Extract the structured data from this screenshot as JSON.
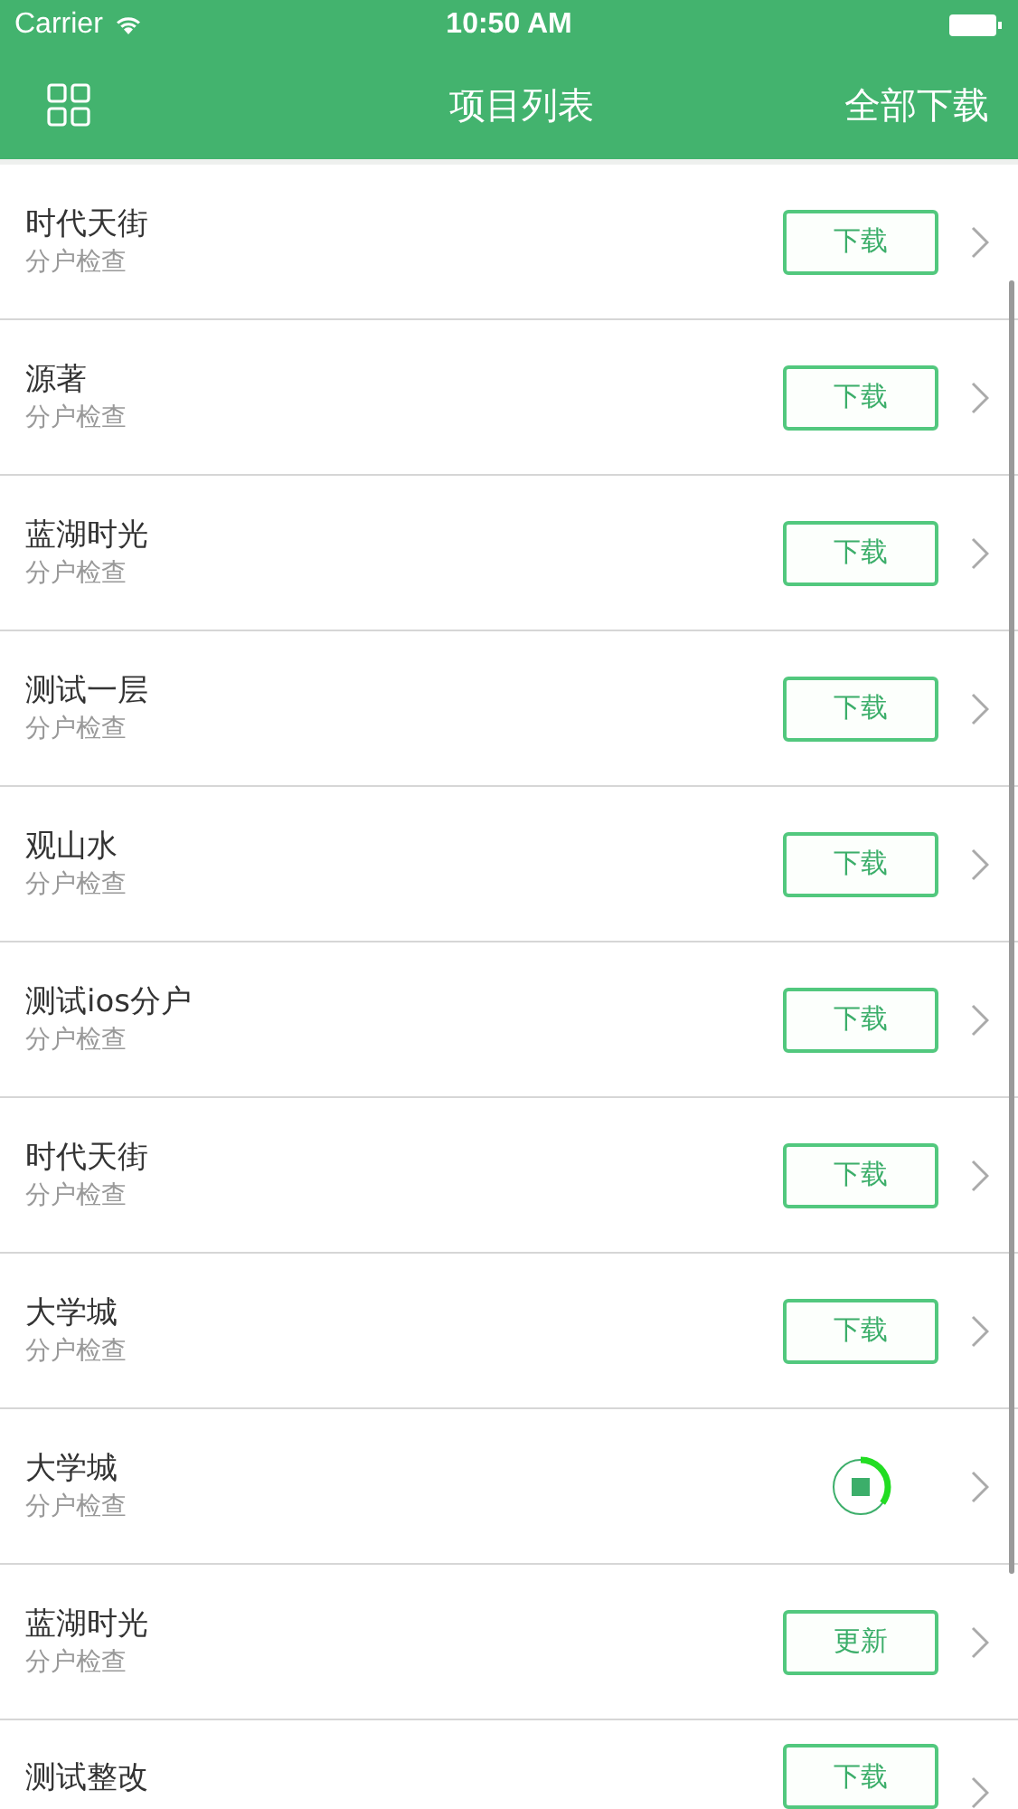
{
  "status_bar": {
    "carrier": "Carrier",
    "time": "10:50 AM"
  },
  "nav_bar": {
    "title": "项目列表",
    "right_action": "全部下载"
  },
  "rows": [
    {
      "title": "时代天街",
      "subtitle": "分户检查",
      "kind": "button",
      "action": "下载"
    },
    {
      "title": "源著",
      "subtitle": "分户检查",
      "kind": "button",
      "action": "下载"
    },
    {
      "title": "蓝湖时光",
      "subtitle": "分户检查",
      "kind": "button",
      "action": "下载"
    },
    {
      "title": "测试一层",
      "subtitle": "分户检查",
      "kind": "button",
      "action": "下载"
    },
    {
      "title": "观山水",
      "subtitle": "分户检查",
      "kind": "button",
      "action": "下载"
    },
    {
      "title": "测试ios分户",
      "subtitle": "分户检查",
      "kind": "button",
      "action": "下载"
    },
    {
      "title": "时代天街",
      "subtitle": "分户检查",
      "kind": "button",
      "action": "下载"
    },
    {
      "title": "大学城",
      "subtitle": "分户检查",
      "kind": "button",
      "action": "下载"
    },
    {
      "title": "大学城",
      "subtitle": "分户检查",
      "kind": "progress",
      "level": 0.35
    },
    {
      "title": "蓝湖时光",
      "subtitle": "分户检查",
      "kind": "button",
      "action": "更新"
    },
    {
      "title": "测试整改",
      "kind": "button",
      "action": "下载"
    }
  ]
}
